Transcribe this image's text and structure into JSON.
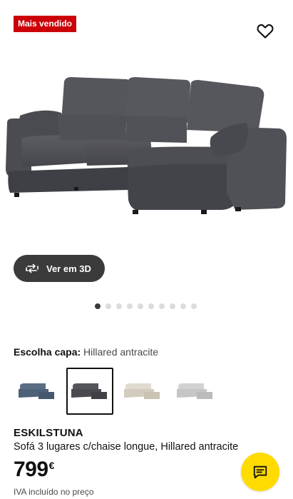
{
  "product": {
    "badge": "Mais vendido",
    "name": "ESKILSTUNA",
    "description": "Sofá 3 lugares c/chaise longue, Hillared antracite",
    "price": "799",
    "currency": "€",
    "vat_note": "IVA incluído no preço"
  },
  "gallery": {
    "view_3d_label": "Ver em 3D",
    "dot_count": 10,
    "active_dot": 0
  },
  "cover": {
    "label": "Escolha capa:",
    "selected_value": "Hillared antracite",
    "options": [
      {
        "name": "blue",
        "color": "#4d6178"
      },
      {
        "name": "anthracite",
        "color": "#4a4b50"
      },
      {
        "name": "beige",
        "color": "#d9d3c6"
      },
      {
        "name": "light-grey",
        "color": "#c9c9c9"
      }
    ],
    "selected_index": 1
  },
  "colors": {
    "badge": "#cc0008",
    "chat": "#ffdb00",
    "sofa": "#4f5055"
  },
  "icons": {
    "favourite": "heart-icon",
    "view3d": "rotate-3d-icon",
    "chat": "chat-icon"
  }
}
